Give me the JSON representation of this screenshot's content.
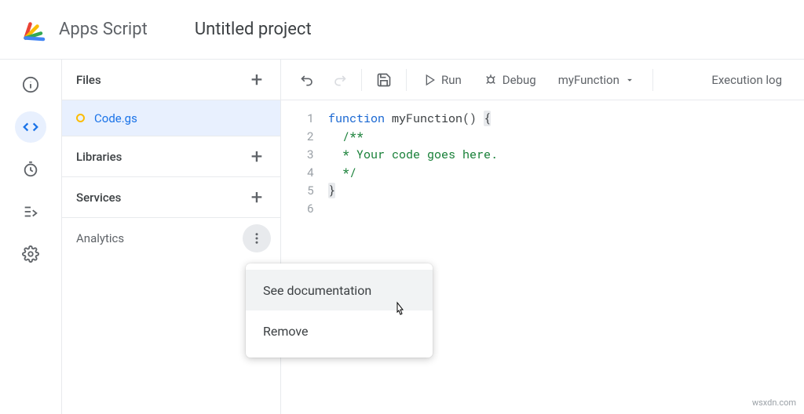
{
  "header": {
    "app_name": "Apps Script",
    "project_title": "Untitled project"
  },
  "sidebar": {
    "files_label": "Files",
    "file_name": "Code.gs",
    "libraries_label": "Libraries",
    "services_label": "Services",
    "analytics_label": "Analytics"
  },
  "toolbar": {
    "run_label": "Run",
    "debug_label": "Debug",
    "function_name": "myFunction",
    "exec_log_label": "Execution log"
  },
  "editor": {
    "lines": [
      "1",
      "2",
      "3",
      "4",
      "5",
      "6"
    ],
    "code": {
      "l1_kw": "function",
      "l1_rest": " myFunction() ",
      "l1_brace": "{",
      "l2": "  /**",
      "l3": "  * Your code goes here.",
      "l4": "  */",
      "l5": "}"
    }
  },
  "menu": {
    "item1": "See documentation",
    "item2": "Remove"
  },
  "watermark": "wsxdn.com"
}
